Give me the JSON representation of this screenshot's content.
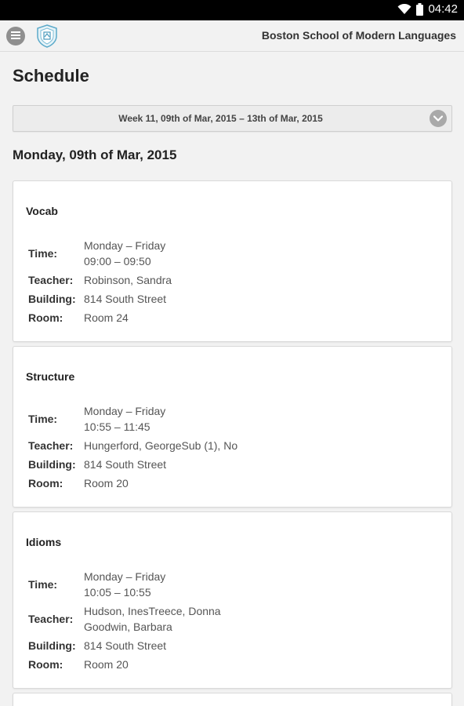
{
  "status_bar": {
    "time": "04:42"
  },
  "header": {
    "app_title": "Boston School of Modern Languages"
  },
  "page_title": "Schedule",
  "week_selector": {
    "label": "Week 11, 09th of Mar, 2015 – 13th of Mar, 2015"
  },
  "day_heading": "Monday, 09th of Mar, 2015",
  "labels": {
    "time": "Time:",
    "teacher": "Teacher:",
    "building": "Building:",
    "room": "Room:"
  },
  "classes": [
    {
      "title": "Vocab",
      "days": "Monday – Friday",
      "time": "09:00 – 09:50",
      "teacher_line1": "Robinson, Sandra",
      "teacher_line2": "",
      "building": "814 South Street",
      "room": "Room 24"
    },
    {
      "title": "Structure",
      "days": "Monday – Friday",
      "time": "10:55 – 11:45",
      "teacher_line1": "Hungerford, GeorgeSub (1), No",
      "teacher_line2": "",
      "building": "814 South Street",
      "room": "Room 20"
    },
    {
      "title": "Idioms",
      "days": "Monday – Friday",
      "time": "10:05 – 10:55",
      "teacher_line1": "Hudson, InesTreece, Donna",
      "teacher_line2": "Goodwin, Barbara",
      "building": "814 South Street",
      "room": "Room 20"
    }
  ]
}
